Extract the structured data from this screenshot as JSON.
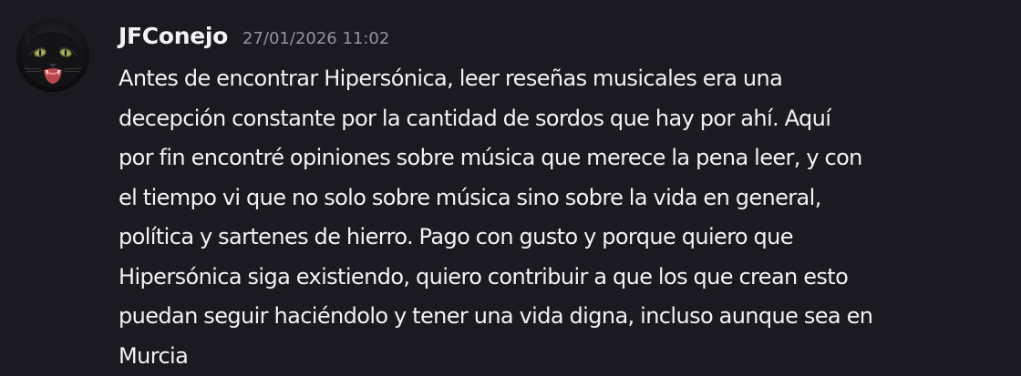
{
  "message": {
    "author": "JFConejo",
    "timestamp": "27/01/2026 11:02",
    "avatar_icon": "black-cat-avatar",
    "lines": [
      "Antes de encontrar Hipersónica, leer reseñas musicales era una",
      "decepción constante por la cantidad de sordos que hay por ahí. Aquí",
      "por fin encontré opiniones sobre música que merece la pena leer, y con",
      "el tiempo vi que no solo sobre música sino sobre la vida en general,",
      "política y sartenes de hierro. Pago con gusto y porque quiero que",
      "Hipersónica siga existiendo, quiero contribuir a que los que crean esto",
      "puedan seguir haciéndolo y tener una vida digna, incluso aunque sea en",
      "Murcia"
    ]
  },
  "colors": {
    "background": "#1b1a21",
    "text": "#f2f3f5",
    "timestamp": "#94959c"
  }
}
